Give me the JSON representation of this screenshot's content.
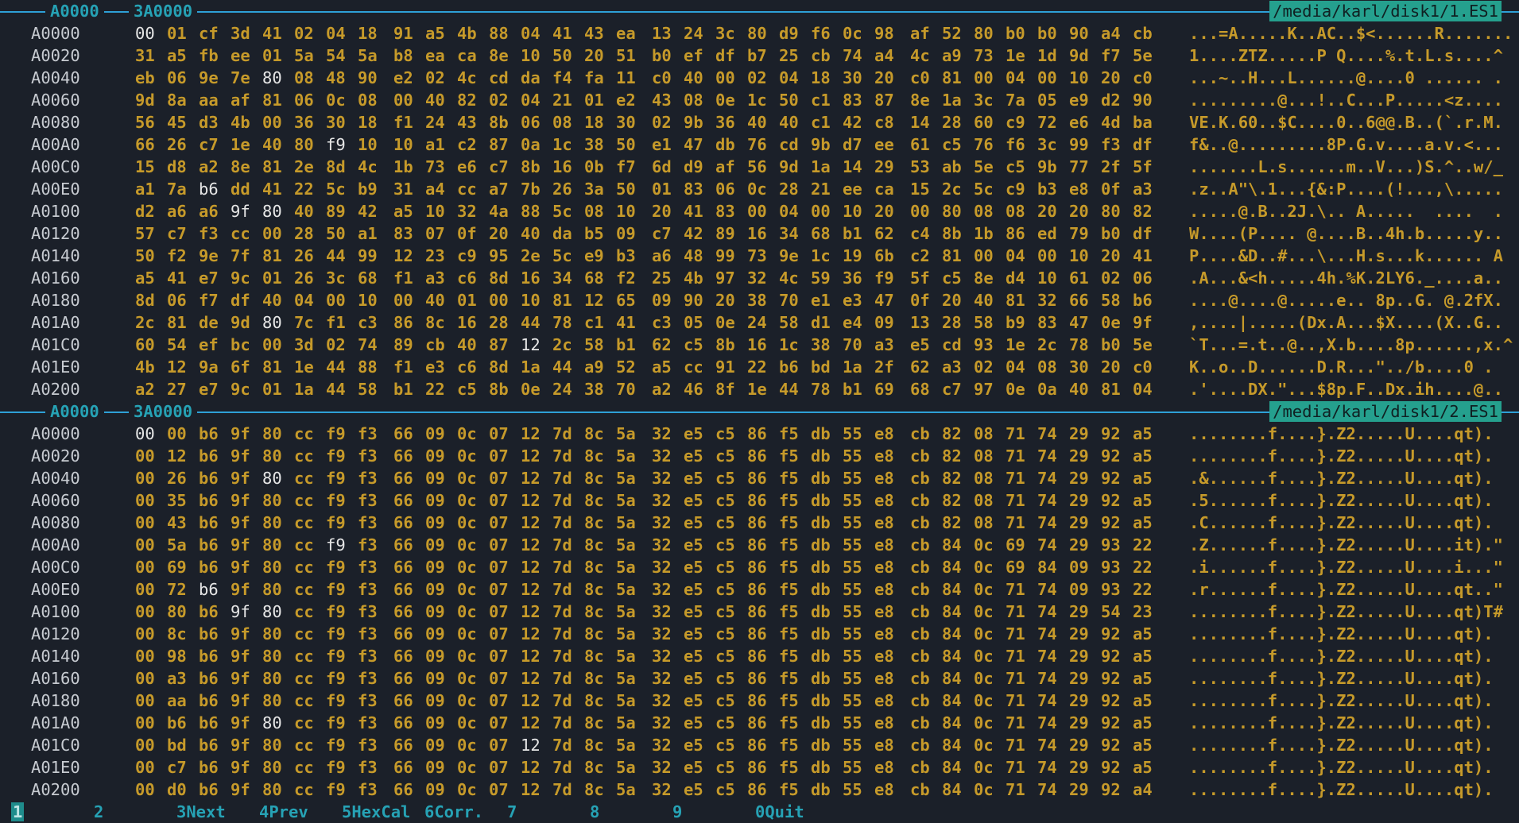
{
  "panes": [
    {
      "header": {
        "addr1": "A0000",
        "addr2": "3A0000",
        "file": "/media/karl/disk1/1.ES1"
      },
      "rows": [
        {
          "off": "A0000",
          "hex": "00 01 cf 3d 41 02 04 18 91 a5 4b 88 04 41 43 ea 13 24 3c 80 d9 f6 0c 98 af 52 80 b0 b0 90 a4 cb",
          "ascii": "...=A.....K..AC..$<......R.......",
          "white": [
            0
          ]
        },
        {
          "off": "A0020",
          "hex": "31 a5 fb ee 01 5a 54 5a b8 ea ca 8e 10 50 20 51 b0 ef df b7 25 cb 74 a4 4c a9 73 1e 1d 9d f7 5e",
          "ascii": "1....ZTZ.....P Q....%.t.L.s....^",
          "white": []
        },
        {
          "off": "A0040",
          "hex": "eb 06 9e 7e 80 08 48 90 e2 02 4c cd da f4 fa 11 c0 40 00 02 04 18 30 20 c0 81 00 04 00 10 20 c0",
          "ascii": "...~..H...L......@....0 ...... .",
          "white": [
            4
          ]
        },
        {
          "off": "A0060",
          "hex": "9d 8a aa af 81 06 0c 08 00 40 82 02 04 21 01 e2 43 08 0e 1c 50 c1 83 87 8e 1a 3c 7a 05 e9 d2 90",
          "ascii": ".........@...!..C...P.....<z....",
          "white": []
        },
        {
          "off": "A0080",
          "hex": "56 45 d3 4b 00 36 30 18 f1 24 43 8b 06 08 18 30 02 9b 36 40 40 c1 42 c8 14 28 60 c9 72 e6 4d ba",
          "ascii": "VE.K.60..$C....0..6@@.B..(`.r.M.",
          "white": []
        },
        {
          "off": "A00A0",
          "hex": "66 26 c7 1e 40 80 f9 10 10 a1 c2 87 0a 1c 38 50 e1 47 db 76 cd 9b d7 ee 61 c5 76 f6 3c 99 f3 df",
          "ascii": "f&..@.........8P.G.v....a.v.<...",
          "white": [
            6
          ]
        },
        {
          "off": "A00C0",
          "hex": "15 d8 a2 8e 81 2e 8d 4c 1b 73 e6 c7 8b 16 0b f7 6d d9 af 56 9d 1a 14 29 53 ab 5e c5 9b 77 2f 5f",
          "ascii": ".......L.s......m..V...)S.^..w/_",
          "white": []
        },
        {
          "off": "A00E0",
          "hex": "a1 7a b6 dd 41 22 5c b9 31 a4 cc a7 7b 26 3a 50 01 83 06 0c 28 21 ee ca 15 2c 5c c9 b3 e8 0f a3",
          "ascii": ".z..A\"\\.1...{&:P....(!...,\\.....",
          "white": [
            2
          ]
        },
        {
          "off": "A0100",
          "hex": "d2 a6 a6 9f 80 40 89 42 a5 10 32 4a 88 5c 08 10 20 41 83 00 04 00 10 20 00 80 08 08 20 20 80 82",
          "ascii": ".....@.B..2J.\\.. A.....  ....  .",
          "white": [
            3,
            4
          ]
        },
        {
          "off": "A0120",
          "hex": "57 c7 f3 cc 00 28 50 a1 83 07 0f 20 40 da b5 09 c7 42 89 16 34 68 b1 62 c4 8b 1b 86 ed 79 b0 df",
          "ascii": "W....(P.... @....B..4h.b.....y..",
          "white": []
        },
        {
          "off": "A0140",
          "hex": "50 f2 9e 7f 81 26 44 99 12 23 c9 95 2e 5c e9 b3 a6 48 99 73 9e 1c 19 6b c2 81 00 04 00 10 20 41",
          "ascii": "P....&D..#...\\...H.s...k...... A",
          "white": []
        },
        {
          "off": "A0160",
          "hex": "a5 41 e7 9c 01 26 3c 68 f1 a3 c6 8d 16 34 68 f2 25 4b 97 32 4c 59 36 f9 5f c5 8e d4 10 61 02 06",
          "ascii": ".A...&<h.....4h.%K.2LY6._....a..",
          "white": []
        },
        {
          "off": "A0180",
          "hex": "8d 06 f7 df 40 04 00 10 00 40 01 00 10 81 12 65 09 90 20 38 70 e1 e3 47 0f 20 40 81 32 66 58 b6",
          "ascii": "....@....@.....e.. 8p..G. @.2fX.",
          "white": []
        },
        {
          "off": "A01A0",
          "hex": "2c 81 de 9d 80 7c f1 c3 86 8c 16 28 44 78 c1 41 c3 05 0e 24 58 d1 e4 09 13 28 58 b9 83 47 0e 9f",
          "ascii": ",....|.....(Dx.A...$X....(X..G..",
          "white": [
            4
          ]
        },
        {
          "off": "A01C0",
          "hex": "60 54 ef bc 00 3d 02 74 89 cb 40 87 12 2c 58 b1 62 c5 8b 16 1c 38 70 a3 e5 cd 93 1e 2c 78 b0 5e",
          "ascii": "`T...=.t..@..,X.b....8p......,x.^",
          "white": [
            12
          ]
        },
        {
          "off": "A01E0",
          "hex": "4b 12 9a 6f 81 1e 44 88 f1 e3 c6 8d 1a 44 a9 52 a5 cc 91 22 b6 bd 1a 2f 62 a3 02 04 08 30 20 c0",
          "ascii": "K..o..D......D.R...\"../b....0 .",
          "white": []
        },
        {
          "off": "A0200",
          "hex": "a2 27 e7 9c 01 1a 44 58 b1 22 c5 8b 0e 24 38 70 a2 46 8f 1e 44 78 b1 69 68 c7 97 0e 0a 40 81 04",
          "ascii": ".'....DX.\"...$8p.F..Dx.ih....@..",
          "white": []
        }
      ]
    },
    {
      "header": {
        "addr1": "A0000",
        "addr2": "3A0000",
        "file": "/media/karl/disk1/2.ES1"
      },
      "rows": [
        {
          "off": "A0000",
          "hex": "00 00 b6 9f 80 cc f9 f3 66 09 0c 07 12 7d 8c 5a 32 e5 c5 86 f5 db 55 e8 cb 82 08 71 74 29 92 a5",
          "ascii": "........f....}.Z2.....U....qt).",
          "white": [
            0
          ]
        },
        {
          "off": "A0020",
          "hex": "00 12 b6 9f 80 cc f9 f3 66 09 0c 07 12 7d 8c 5a 32 e5 c5 86 f5 db 55 e8 cb 82 08 71 74 29 92 a5",
          "ascii": "........f....}.Z2.....U....qt).",
          "white": []
        },
        {
          "off": "A0040",
          "hex": "00 26 b6 9f 80 cc f9 f3 66 09 0c 07 12 7d 8c 5a 32 e5 c5 86 f5 db 55 e8 cb 82 08 71 74 29 92 a5",
          "ascii": ".&......f....}.Z2.....U....qt).",
          "white": [
            4
          ]
        },
        {
          "off": "A0060",
          "hex": "00 35 b6 9f 80 cc f9 f3 66 09 0c 07 12 7d 8c 5a 32 e5 c5 86 f5 db 55 e8 cb 82 08 71 74 29 92 a5",
          "ascii": ".5......f....}.Z2.....U....qt).",
          "white": []
        },
        {
          "off": "A0080",
          "hex": "00 43 b6 9f 80 cc f9 f3 66 09 0c 07 12 7d 8c 5a 32 e5 c5 86 f5 db 55 e8 cb 82 08 71 74 29 92 a5",
          "ascii": ".C......f....}.Z2.....U....qt).",
          "white": []
        },
        {
          "off": "A00A0",
          "hex": "00 5a b6 9f 80 cc f9 f3 66 09 0c 07 12 7d 8c 5a 32 e5 c5 86 f5 db 55 e8 cb 84 0c 69 74 29 93 22",
          "ascii": ".Z......f....}.Z2.....U....it).\"",
          "white": [
            6
          ]
        },
        {
          "off": "A00C0",
          "hex": "00 69 b6 9f 80 cc f9 f3 66 09 0c 07 12 7d 8c 5a 32 e5 c5 86 f5 db 55 e8 cb 84 0c 69 84 09 93 22",
          "ascii": ".i......f....}.Z2.....U....i...\"",
          "white": []
        },
        {
          "off": "A00E0",
          "hex": "00 72 b6 9f 80 cc f9 f3 66 09 0c 07 12 7d 8c 5a 32 e5 c5 86 f5 db 55 e8 cb 84 0c 71 74 09 93 22",
          "ascii": ".r......f....}.Z2.....U....qt..\"",
          "white": [
            2
          ]
        },
        {
          "off": "A0100",
          "hex": "00 80 b6 9f 80 cc f9 f3 66 09 0c 07 12 7d 8c 5a 32 e5 c5 86 f5 db 55 e8 cb 84 0c 71 74 29 54 23",
          "ascii": "........f....}.Z2.....U....qt)T#",
          "white": [
            3,
            4
          ]
        },
        {
          "off": "A0120",
          "hex": "00 8c b6 9f 80 cc f9 f3 66 09 0c 07 12 7d 8c 5a 32 e5 c5 86 f5 db 55 e8 cb 84 0c 71 74 29 92 a5",
          "ascii": "........f....}.Z2.....U....qt).",
          "white": []
        },
        {
          "off": "A0140",
          "hex": "00 98 b6 9f 80 cc f9 f3 66 09 0c 07 12 7d 8c 5a 32 e5 c5 86 f5 db 55 e8 cb 84 0c 71 74 29 92 a5",
          "ascii": "........f....}.Z2.....U....qt).",
          "white": []
        },
        {
          "off": "A0160",
          "hex": "00 a3 b6 9f 80 cc f9 f3 66 09 0c 07 12 7d 8c 5a 32 e5 c5 86 f5 db 55 e8 cb 84 0c 71 74 29 92 a5",
          "ascii": "........f....}.Z2.....U....qt).",
          "white": []
        },
        {
          "off": "A0180",
          "hex": "00 aa b6 9f 80 cc f9 f3 66 09 0c 07 12 7d 8c 5a 32 e5 c5 86 f5 db 55 e8 cb 84 0c 71 74 29 92 a5",
          "ascii": "........f....}.Z2.....U....qt).",
          "white": []
        },
        {
          "off": "A01A0",
          "hex": "00 b6 b6 9f 80 cc f9 f3 66 09 0c 07 12 7d 8c 5a 32 e5 c5 86 f5 db 55 e8 cb 84 0c 71 74 29 92 a5",
          "ascii": "........f....}.Z2.....U....qt).",
          "white": [
            4
          ]
        },
        {
          "off": "A01C0",
          "hex": "00 bd b6 9f 80 cc f9 f3 66 09 0c 07 12 7d 8c 5a 32 e5 c5 86 f5 db 55 e8 cb 84 0c 71 74 29 92 a5",
          "ascii": "........f....}.Z2.....U....qt).",
          "white": [
            12
          ]
        },
        {
          "off": "A01E0",
          "hex": "00 c7 b6 9f 80 cc f9 f3 66 09 0c 07 12 7d 8c 5a 32 e5 c5 86 f5 db 55 e8 cb 84 0c 71 74 29 92 a5",
          "ascii": "........f....}.Z2.....U....qt).",
          "white": []
        },
        {
          "off": "A0200",
          "hex": "00 d0 b6 9f 80 cc f9 f3 66 09 0c 07 12 7d 8c 5a 32 e5 c5 86 f5 db 55 e8 cb 84 0c 71 74 29 92 a4",
          "ascii": "........f....}.Z2.....U....qt).",
          "white": []
        }
      ]
    }
  ],
  "fkeys": [
    {
      "num": "1",
      "label": ""
    },
    {
      "num": "2",
      "label": ""
    },
    {
      "num": "3",
      "label": "Next"
    },
    {
      "num": "4",
      "label": "Prev"
    },
    {
      "num": "5",
      "label": "HexCal"
    },
    {
      "num": "6",
      "label": "Corr."
    },
    {
      "num": "7",
      "label": ""
    },
    {
      "num": "8",
      "label": ""
    },
    {
      "num": "9",
      "label": ""
    },
    {
      "num": "0",
      "label": "Quit"
    }
  ],
  "colors": {
    "background": "#1b2029",
    "hex": "#c69a2a",
    "accent": "#26a2b5",
    "file_badge": "#25a08e"
  }
}
